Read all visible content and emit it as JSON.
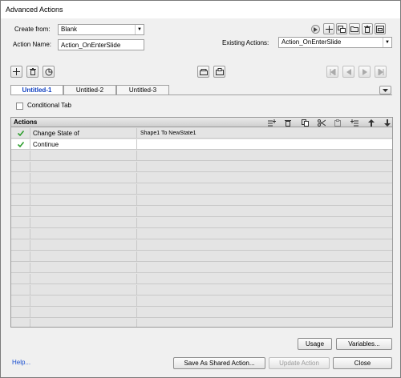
{
  "window": {
    "title": "Advanced Actions"
  },
  "form": {
    "create_from_label": "Create from:",
    "create_from_value": "Blank",
    "action_name_label": "Action Name:",
    "action_name_value": "Action_OnEnterSlide",
    "existing_actions_label": "Existing Actions:",
    "existing_actions_value": "Action_OnEnterSlide"
  },
  "tabs": [
    {
      "label": "Untitled-1",
      "active": true
    },
    {
      "label": "Untitled-2",
      "active": false
    },
    {
      "label": "Untitled-3",
      "active": false
    }
  ],
  "conditional_tab_label": "Conditional Tab",
  "grid": {
    "title": "Actions",
    "rows": [
      {
        "check": true,
        "action": "Change State of",
        "target": "Shape1   To   NewState1"
      },
      {
        "check": true,
        "action": "Continue",
        "target": ""
      }
    ]
  },
  "buttons": {
    "usage": "Usage",
    "variables": "Variables...",
    "save_shared": "Save As Shared Action...",
    "update_action": "Update Action",
    "close": "Close"
  },
  "help_link": "Help...",
  "colors": {
    "check": "#2e9e2e",
    "link": "#1a4fd0",
    "active_tab": "#1040c0"
  }
}
